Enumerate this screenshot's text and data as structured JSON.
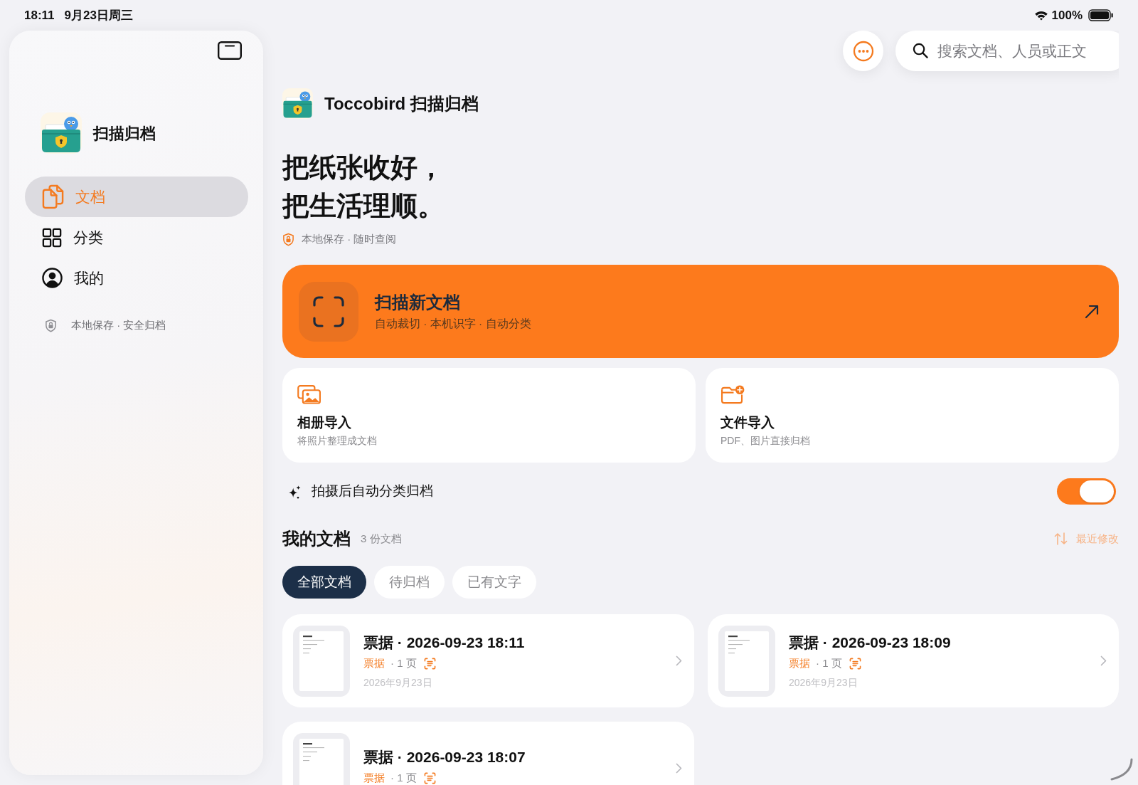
{
  "status_bar": {
    "time": "18:11",
    "date": "9月23日周三",
    "battery": "100%"
  },
  "sidebar": {
    "app_name": "扫描归档",
    "items": [
      {
        "kind": "documents",
        "label": "文档",
        "selected": true
      },
      {
        "kind": "categories",
        "label": "分类",
        "selected": false
      },
      {
        "kind": "profile",
        "label": "我的",
        "selected": false
      }
    ],
    "footer": "本地保存 · 安全归档"
  },
  "search": {
    "placeholder": "搜索文档、人员或正文"
  },
  "header": {
    "title": "Toccobird 扫描归档",
    "headline": [
      "把纸张收好，",
      "把生活理顺。"
    ],
    "tagline": "本地保存 · 随时查阅"
  },
  "scan_card": {
    "title": "扫描新文档",
    "subtitle": "自动裁切 · 本机识字 · 自动分类"
  },
  "import_options": [
    {
      "kind": "photos",
      "title": "相册导入",
      "subtitle": "将照片整理成文档"
    },
    {
      "kind": "files",
      "title": "文件导入",
      "subtitle": "PDF、图片直接归档"
    }
  ],
  "auto_archive": {
    "label": "拍摄后自动分类归档",
    "on": true
  },
  "documents": {
    "title": "我的文档",
    "count": "3 份文档",
    "sort": "最近修改",
    "filters": [
      {
        "label": "全部文档",
        "selected": true
      },
      {
        "label": "待归档",
        "selected": false
      },
      {
        "label": "已有文字",
        "selected": false
      }
    ],
    "items": [
      {
        "title": "票据 · 2026-09-23 18:11",
        "category": "票据",
        "pages": "· 1 页",
        "has_text": true,
        "date": "2026年9月23日"
      },
      {
        "title": "票据 · 2026-09-23 18:09",
        "category": "票据",
        "pages": "· 1 页",
        "has_text": true,
        "date": "2026年9月23日"
      },
      {
        "title": "票据 · 2026-09-23 18:07",
        "category": "票据",
        "pages": "· 1 页",
        "has_text": true
      }
    ]
  }
}
